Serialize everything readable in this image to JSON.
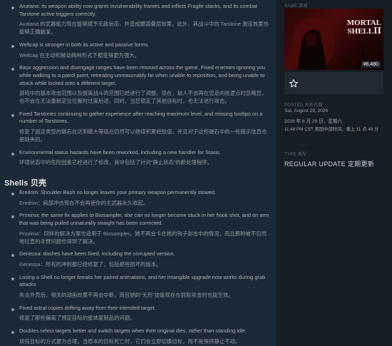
{
  "notes_top": [
    {
      "en": "Axatana: its weapon ability now grants invulnerability frames and inflicts Fragile stacks, and its combat Tarstone active triggers correctly.",
      "zh": "Axatana 的武器能力现在能够赋予无敌状态，并造成脆弱叠层效果。此外，其战斗中的 Tarstone 激活效果也能够正确触发。"
    },
    {
      "en": "Weltcap is stronger in both its active and passive forms.",
      "zh": "Weltcap 在主动和被动两种形式下都变得更为强大。"
    },
    {
      "en": "Base aggression and disengage ranges have been retuned across the game. Fixed enemies ignoring you while walking to a patrol point, retreating unreasonably far when unable to reposition, and being unable to attack while locked onto a different target.",
      "zh": "游戏中的基本攻击范围以及脱离战斗的范围已经进行了调整。现在，敌人不会再在您走向巡逻点时忽略您，也不会在无法重新定位位置时过度后退，同时，当您锁定了其他目标时，也无法进行攻击。"
    },
    {
      "en": "Fixed Tarstones continuing to gather experience after reaching maximum level, and missing tooltips on a number of Tarstones.",
      "zh": "修复了固定类型的碳石在达到最大等级后仍然可以继续积累经验值，并且对于这些碳石中的一些提示信息也是缺失的。"
    },
    {
      "en": "Environmental status hazards have been reworked, including a new handler for Stasis.",
      "zh": "环境状态中的危险因素已经进行了修改，其中包括了针对“静止状态”的新处理程序。"
    }
  ],
  "shells_heading": "Shells 贝壳",
  "notes_shells": [
    {
      "en": "Eredrim: Shoulder Bash no longer leaves your primary weapon permanently stowed.",
      "zh": "Eredrim：肩部冲击现在不会再使你的主武器永久收起。"
    },
    {
      "en": "Proxima: the same fix applies to Biosampler, she can no longer become stuck in her hook shot, and an arm that was being pulled unnaturally straight has been corrected.",
      "zh": "Proxima：同样的解决方案也适用于 Biosampler。她不再会卡在她的钩子射击中的情况，而且那种被不自然地拉直的手臂问题也得到了解决。"
    },
    {
      "en": "Genessa: dashes have been fixed, including the corrupted version.",
      "zh": "Genessa：所有的冲刺都已经修复了，包括那些损坏的版本。"
    },
    {
      "en": "Losing a Shell no longer breaks her paired animations, and her intangible upgrade now works during grab attacks",
      "zh": "失去外壳后，相关的动画效果不再会中断，而且她的“无形”技能现在在抓取攻击时也能生效。"
    },
    {
      "en": "Fixed astral copies drifting away from their intended target.",
      "zh": "修复了那些偏离了预定目标的星体复制品的问题。"
    },
    {
      "en": "Doubles select targets better and switch targets when their original dies, rather than standing idle.",
      "zh": "双倍目标的方式更为合理。当原本的目标死亡时，它们会立即切换目标，而不是保持静止不动。"
    }
  ],
  "side": {
    "section_label": "SAME 游戏",
    "game_logo_line1": "MORTAL",
    "game_logo_line2": "SHELL",
    "game_logo_numeral": "II",
    "price": "¥6,480",
    "wishlist_icon": "star-outline-icon",
    "posted_label": "POSTED 发布日期",
    "posted_date_en": "Sat, August 29, 2026",
    "posted_date_zh": "2026 年 8 月 29 日，星期六",
    "posted_time": "11:48 PM CST 美国中部时间，晚上 11 点 48 分",
    "type_label": "TYPE 类型",
    "type_value": "REGULAR UPDATE 定期更新"
  },
  "colors": {
    "page_bg": "#1b2838",
    "side_bg": "#171d25",
    "price_bg": "#212a33",
    "logo_red": "#b01818"
  }
}
